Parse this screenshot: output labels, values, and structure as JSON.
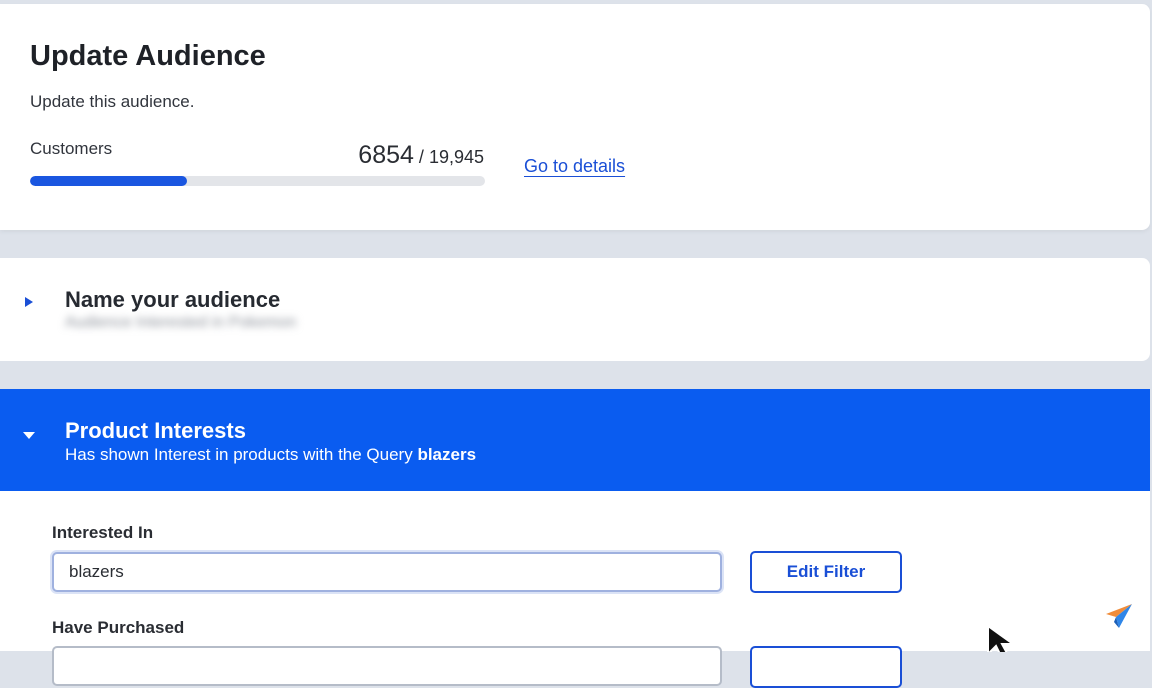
{
  "header": {
    "title": "Update Audience",
    "subtitle": "Update this audience."
  },
  "customers": {
    "label": "Customers",
    "current": "6854",
    "separator": " / ",
    "total": "19,945",
    "progress_fraction": 0.344,
    "details_link": "Go to details"
  },
  "name_section": {
    "title": "Name your audience",
    "value_blurred": "Audience Interested in Pokemon"
  },
  "product_interests": {
    "title": "Product Interests",
    "description_prefix": "Has shown Interest in products with the Query ",
    "query": "blazers"
  },
  "form": {
    "interested_label": "Interested In",
    "interested_value": "blazers",
    "edit_filter_label": "Edit Filter",
    "purchased_label": "Have Purchased",
    "purchased_value": ""
  },
  "colors": {
    "accent": "#1a4fd6",
    "band": "#0a5cf0",
    "progress_fill": "#1a56e0"
  },
  "icons": {
    "collapsed": "caret-right-icon",
    "expanded": "caret-down-icon",
    "pointer": "mouse-pointer-icon",
    "brand": "paper-plane-icon"
  }
}
